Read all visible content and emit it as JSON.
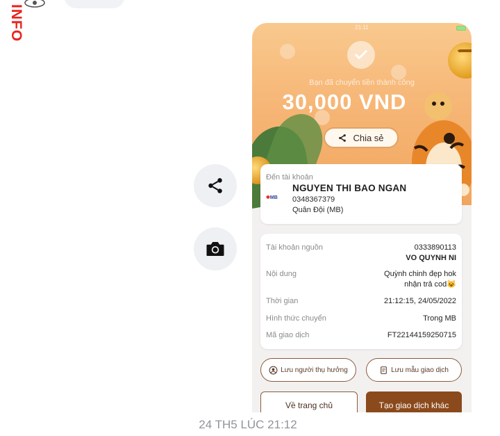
{
  "watermark": {
    "text": "INFO"
  },
  "side_actions": {
    "share_icon": "share-icon",
    "camera_icon": "camera-icon"
  },
  "receipt": {
    "status_time": "21:11",
    "success_message": "Bạn đã chuyển tiền thành công",
    "amount": "30,000 VND",
    "share_label": "Chia sẻ",
    "destination": {
      "label": "Đến tài khoản",
      "bank_logo": "MB",
      "name": "NGUYEN THI BAO NGAN",
      "account": "0348367379",
      "bank": "Quân Đội (MB)"
    },
    "details": {
      "source_label": "Tài khoản nguồn",
      "source_account": "0333890113",
      "source_name": "VO QUYNH NI",
      "content_label": "Nội dung",
      "content_line1": "Quỳnh chinh đẹp hok",
      "content_line2": "nhận trả cod😺",
      "time_label": "Thời gian",
      "time_value": "21:12:15, 24/05/2022",
      "method_label": "Hình thức chuyển",
      "method_value": "Trong MB",
      "code_label": "Mã giao dịch",
      "code_value": "FT22144159250715"
    },
    "save_beneficiary": "Lưu người thụ hưởng",
    "save_template": "Lưu mẫu giao dịch",
    "home_button": "Về trang chủ",
    "new_transaction_button": "Tạo giao dịch khác"
  },
  "timestamp": "24 TH5 LÚC 21:12",
  "colors": {
    "accent_brown": "#8b4a1c",
    "hero_orange": "#f6b676",
    "watermark_red": "#e8241c"
  }
}
